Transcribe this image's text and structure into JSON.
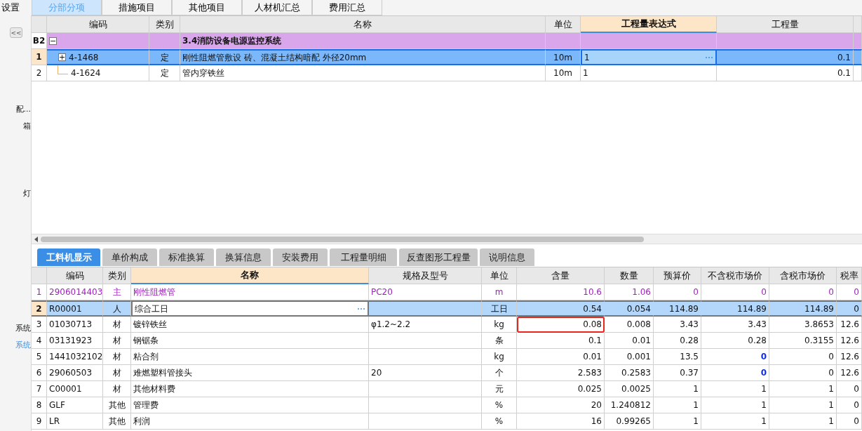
{
  "top_tabs": [
    {
      "label": "设置",
      "selected": false
    },
    {
      "label": "分部分项",
      "selected": true
    },
    {
      "label": "措施项目",
      "selected": false
    },
    {
      "label": "其他项目",
      "selected": false
    },
    {
      "label": "人材机汇总",
      "selected": false
    },
    {
      "label": "费用汇总",
      "selected": false
    }
  ],
  "sidebar": {
    "collapse_button": "<<",
    "items": [
      {
        "label": "配...",
        "selected": false
      },
      {
        "label": "箱",
        "selected": false
      },
      {
        "label": "灯",
        "selected": false
      },
      {
        "label": "系统",
        "selected": false
      },
      {
        "label": "系统",
        "selected": true
      }
    ]
  },
  "upper_table": {
    "columns": [
      {
        "label": "编码",
        "highlighted": false
      },
      {
        "label": "类别",
        "highlighted": false
      },
      {
        "label": "名称",
        "highlighted": false
      },
      {
        "label": "单位",
        "highlighted": false
      },
      {
        "label": "工程量表达式",
        "highlighted": true
      },
      {
        "label": "工程量",
        "highlighted": false
      }
    ],
    "rows": [
      {
        "kind": "section",
        "row_header": "B2",
        "expander": "−",
        "code": "",
        "type": "",
        "name": "3.4消防设备电源监控系统",
        "unit": "",
        "expression": "",
        "quantity": "",
        "selected": false
      },
      {
        "kind": "item",
        "row_header": "1",
        "expander": "+",
        "code": "4-1468",
        "type": "定",
        "name": "刚性阻燃管敷设 砖、混凝土结构暗配 外径20mm",
        "unit": "10m",
        "expression": "1",
        "quantity": "0.1",
        "selected": true
      },
      {
        "kind": "item",
        "row_header": "2",
        "code": "4-1624",
        "type": "定",
        "name": "管内穿铁丝",
        "unit": "10m",
        "expression": "1",
        "quantity": "0.1",
        "selected": false
      }
    ]
  },
  "bottom_tabs": [
    {
      "label": "工料机显示",
      "selected": true
    },
    {
      "label": "单价构成",
      "selected": false
    },
    {
      "label": "标准换算",
      "selected": false
    },
    {
      "label": "换算信息",
      "selected": false
    },
    {
      "label": "安装费用",
      "selected": false
    },
    {
      "label": "工程量明细",
      "selected": false
    },
    {
      "label": "反查图形工程量",
      "selected": false
    },
    {
      "label": "说明信息",
      "selected": false
    }
  ],
  "resource_table": {
    "columns": [
      {
        "label": "编码",
        "highlighted": false
      },
      {
        "label": "类别",
        "highlighted": false
      },
      {
        "label": "名称",
        "highlighted": true
      },
      {
        "label": "规格及型号",
        "highlighted": false
      },
      {
        "label": "单位",
        "highlighted": false
      },
      {
        "label": "含量",
        "highlighted": false
      },
      {
        "label": "数量",
        "highlighted": false
      },
      {
        "label": "预算价",
        "highlighted": false
      },
      {
        "label": "不含税市场价",
        "highlighted": false
      },
      {
        "label": "含税市场价",
        "highlighted": false
      },
      {
        "label": "税率",
        "highlighted": false
      }
    ],
    "rows": [
      {
        "kind": "main",
        "row_header": "1",
        "code": "2906014403",
        "type": "主",
        "name": "刚性阻燃管",
        "spec": "PC20",
        "unit": "m",
        "content": "10.6",
        "amount": "1.06",
        "budget_price": "0",
        "price_ex_tax": "0",
        "price_in_tax": "0",
        "tax_rate": "0",
        "selected": false,
        "content_marked": false,
        "price_ex_tax_emphasis": false
      },
      {
        "kind": "normal",
        "row_header": "2",
        "code": "R00001",
        "type": "人",
        "name": "综合工日",
        "spec": "",
        "unit": "工日",
        "content": "0.54",
        "amount": "0.054",
        "budget_price": "114.89",
        "price_ex_tax": "114.89",
        "price_in_tax": "114.89",
        "tax_rate": "0",
        "selected": true,
        "content_marked": false,
        "price_ex_tax_emphasis": false
      },
      {
        "kind": "normal",
        "row_header": "3",
        "code": "01030713",
        "type": "材",
        "name": "镀锌铁丝",
        "spec": "φ1.2~2.2",
        "unit": "kg",
        "content": "0.08",
        "amount": "0.008",
        "budget_price": "3.43",
        "price_ex_tax": "3.43",
        "price_in_tax": "3.8653",
        "tax_rate": "12.6",
        "selected": false,
        "content_marked": true,
        "price_ex_tax_emphasis": false
      },
      {
        "kind": "normal",
        "row_header": "4",
        "code": "03131923",
        "type": "材",
        "name": "钢锯条",
        "spec": "",
        "unit": "条",
        "content": "0.1",
        "amount": "0.01",
        "budget_price": "0.28",
        "price_ex_tax": "0.28",
        "price_in_tax": "0.3155",
        "tax_rate": "12.6",
        "selected": false,
        "content_marked": false,
        "price_ex_tax_emphasis": false
      },
      {
        "kind": "normal",
        "row_header": "5",
        "code": "1441032102",
        "type": "材",
        "name": "粘合剂",
        "spec": "",
        "unit": "kg",
        "content": "0.01",
        "amount": "0.001",
        "budget_price": "13.5",
        "price_ex_tax": "0",
        "price_in_tax": "0",
        "tax_rate": "12.6",
        "selected": false,
        "content_marked": false,
        "price_ex_tax_emphasis": true
      },
      {
        "kind": "normal",
        "row_header": "6",
        "code": "29060503",
        "type": "材",
        "name": "难燃塑料管接头",
        "spec": "20",
        "unit": "个",
        "content": "2.583",
        "amount": "0.2583",
        "budget_price": "0.37",
        "price_ex_tax": "0",
        "price_in_tax": "0",
        "tax_rate": "12.6",
        "selected": false,
        "content_marked": false,
        "price_ex_tax_emphasis": true
      },
      {
        "kind": "normal",
        "row_header": "7",
        "code": "C00001",
        "type": "材",
        "name": "其他材料费",
        "spec": "",
        "unit": "元",
        "content": "0.025",
        "amount": "0.0025",
        "budget_price": "1",
        "price_ex_tax": "1",
        "price_in_tax": "1",
        "tax_rate": "0",
        "selected": false,
        "content_marked": false,
        "price_ex_tax_emphasis": false
      },
      {
        "kind": "normal",
        "row_header": "8",
        "code": "GLF",
        "type": "其他",
        "name": "管理费",
        "spec": "",
        "unit": "%",
        "content": "20",
        "amount": "1.240812",
        "budget_price": "1",
        "price_ex_tax": "1",
        "price_in_tax": "1",
        "tax_rate": "0",
        "selected": false,
        "content_marked": false,
        "price_ex_tax_emphasis": false
      },
      {
        "kind": "normal",
        "row_header": "9",
        "code": "LR",
        "type": "其他",
        "name": "利润",
        "spec": "",
        "unit": "%",
        "content": "16",
        "amount": "0.99265",
        "budget_price": "1",
        "price_ex_tax": "1",
        "price_in_tax": "1",
        "tax_rate": "0",
        "selected": false,
        "content_marked": false,
        "price_ex_tax_emphasis": false
      }
    ]
  }
}
